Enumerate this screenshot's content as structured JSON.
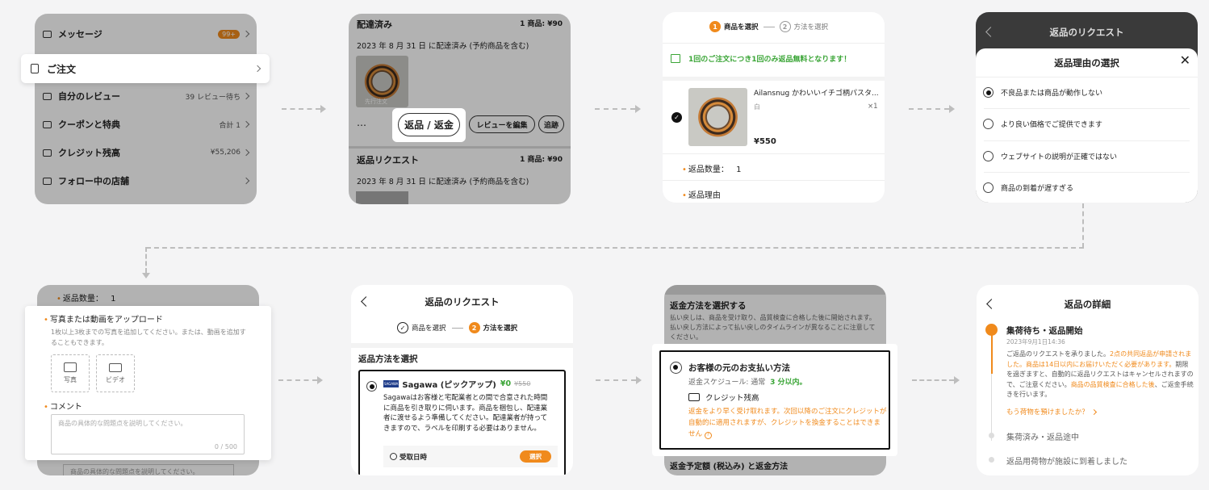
{
  "flow": {
    "s1": {
      "messages": "メッセージ",
      "messages_badge": "99+",
      "orders": "ご注文",
      "reviews": "自分のレビュー",
      "reviews_val": "39 レビュー待ち",
      "coupons": "クーポンと特典",
      "coupons_val": "合計 1",
      "credit": "クレジット残高",
      "credit_val": "¥55,206",
      "follow": "フォロー中の店舗"
    },
    "s2": {
      "delivered": "配達済み",
      "delivered_meta": "1 商品: ¥90",
      "delivered_date": "2023 年 8 月 31 日 に配達済み (予約商品を含む)",
      "img_caption": "先行注文",
      "more": "…",
      "return_btn": "返品 / 返金",
      "review_btn": "レビューを編集",
      "track_btn": "追跡",
      "return_req": "返品リクエスト",
      "return_req_meta": "1 商品: ¥90",
      "return_req_date": "2023 年 8 月 31 日 に配達済み (予約商品を含む)"
    },
    "s3": {
      "step1_num": "1",
      "step1": "商品を選択",
      "step2_num": "2",
      "step2": "方法を選択",
      "banner": "1回のご注文につき1回のみ返品無料となります！",
      "product": "Ailansnug かわいいイチゴ柄パスタ...",
      "variant": "白",
      "qty": "×1",
      "price": "¥550",
      "return_qty_label": "返品数量：",
      "return_qty": "1",
      "reason_label": "返品理由"
    },
    "s4": {
      "title": "返品のリクエスト",
      "sheet_title": "返品理由の選択",
      "reasons": [
        "不良品または商品が動作しない",
        "より良い価格でご提供できます",
        "ウェブサイトの説明が正確ではない",
        "商品の到着が遅すぎる"
      ]
    },
    "s5": {
      "qty_label": "返品数量：",
      "qty": "1",
      "upload_title": "写真または動画をアップロード",
      "upload_desc": "1枚以上3枚までの写真を追加してください。または、動画を追加することもできます。",
      "photo": "写真",
      "video": "ビデオ",
      "comment_title": "コメント",
      "comment_placeholder": "商品の具体的な問題点を説明してください。",
      "counter": "0 / 500",
      "below_placeholder": "商品の具体的な問題点を説明してください。"
    },
    "s6": {
      "title": "返品のリクエスト",
      "step1": "商品を選択",
      "step2_num": "2",
      "step2": "方法を選択",
      "section": "返品方法を選択",
      "carrier_logo": "SAGAWA",
      "carrier": "Sagawa (ピックアップ)",
      "price": "¥0",
      "old_price": "¥550",
      "desc": "Sagawaはお客様と宅配業者との間で合意された時間に商品を引き取りに伺います。商品を梱包し、配達業者に渡せるよう準備してください。配達業者が持ってきますので、ラベルを印刷する必要はありません。",
      "pickup_label": "受取日時",
      "select_btn": "選択"
    },
    "s7": {
      "header": "返金方法を選択する",
      "header_desc": "払い戻しは、商品を受け取り、品質検査に合格した後に開始されます。払い戻し方法によって払い戻しのタイムラインが異なることに注意してください。",
      "option": "お客様の元のお支払い方法",
      "schedule_prefix": "返金スケジュール: 通常",
      "schedule_value": "3 分以内。",
      "credit": "クレジット残高",
      "note": "返金をより早く受け取れます。次回以降のご注文にクレジットが自動的に適用されますが、クレジットを換金することはできません",
      "footer": "返金予定額 (税込み) と返金方法"
    },
    "s8": {
      "title": "返品の詳細",
      "status": "集荷待ち・返品開始",
      "time": "2023年9月1日14:36",
      "msg_a": "ご返品のリクエストを承りました。",
      "msg_b": "2点の共同返品が申請されました。",
      "msg_c": "商品は14日以内にお届けいただく必要があります。",
      "msg_d": "期限を過ぎますと、自動的に返品リクエストはキャンセルされますので、ご注意ください。",
      "msg_e": "商品の品質検査に合格した後",
      "msg_f": "、ご返金手続きを行います。",
      "link": "もう荷物を預けましたか？",
      "step2": "集荷済み・返品途中",
      "step3": "返品用荷物が施設に到着しました"
    }
  },
  "colors": {
    "accent": "#f08a1c",
    "green": "#3aa536",
    "dim": "rgba(0,0,0,0.30)"
  }
}
